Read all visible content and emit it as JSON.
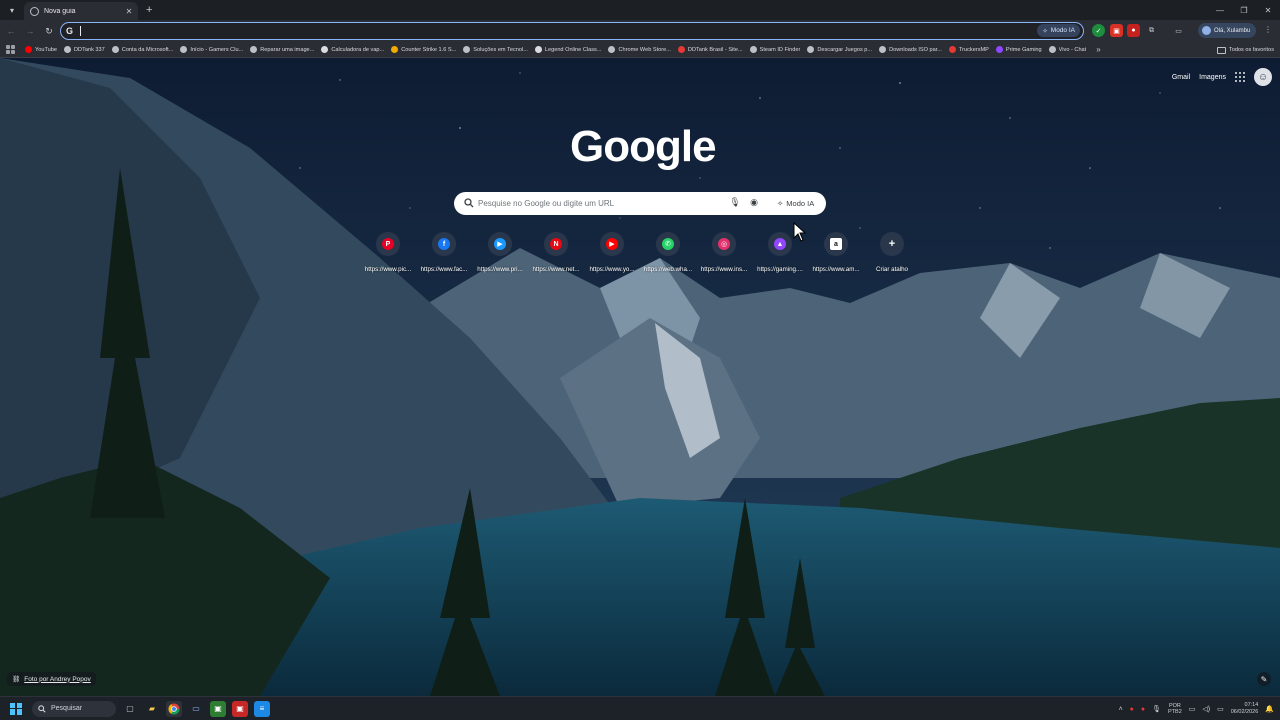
{
  "colors": {
    "accent": "#8ab4f8",
    "tab_bg": "#2a2d33",
    "frame_bg": "#1c1f24",
    "search_bg": "#ffffff"
  },
  "tabstrip": {
    "tab_title": "Nova guia",
    "close_icon": "close-icon",
    "new_tab_icon": "plus-icon"
  },
  "toolbar": {
    "omnibox_value": "",
    "omnibox_modo_ia": "Modo IA",
    "profile_label": "Olá, Xulambu"
  },
  "bookmarks": {
    "items": [
      {
        "label": "YouTube",
        "color": "#ff0000"
      },
      {
        "label": "DDTank 337",
        "color": "#bdc1c6"
      },
      {
        "label": "Conta da Microsoft...",
        "color": "#bdc1c6"
      },
      {
        "label": "Início - Gamers Clu...",
        "color": "#bdc1c6"
      },
      {
        "label": "Reparar uma image...",
        "color": "#bdc1c6"
      },
      {
        "label": "Calculadora de vap...",
        "color": "#dadce0"
      },
      {
        "label": "Counter Strike 1.6 S...",
        "color": "#f2a900"
      },
      {
        "label": "Soluções em Tecnol...",
        "color": "#bdc1c6"
      },
      {
        "label": "Legend Online Class...",
        "color": "#dadce0"
      },
      {
        "label": "Chrome Web Store...",
        "color": "#bdc1c6"
      },
      {
        "label": "DDTank Brasil - Site...",
        "color": "#e53935"
      },
      {
        "label": "Steam ID Finder",
        "color": "#bdc1c6"
      },
      {
        "label": "Descargar Juegos p...",
        "color": "#bdc1c6"
      },
      {
        "label": "Downloads ISO par...",
        "color": "#bdc1c6"
      },
      {
        "label": "TruckersMP",
        "color": "#e53935"
      },
      {
        "label": "Prime Gaming",
        "color": "#9146ff"
      },
      {
        "label": "Vivo - Chat",
        "color": "#bdc1c6"
      }
    ],
    "all_label": "Todos os favoritos"
  },
  "page": {
    "top_links": {
      "gmail": "Gmail",
      "images": "Imagens"
    },
    "logo": "Google",
    "search": {
      "placeholder": "Pesquise no Google ou digite um URL",
      "modo_ia": "Modo IA"
    },
    "shortcuts": [
      {
        "label": "https://www.pic...",
        "icon": "pinterest-icon",
        "color": "#e60023",
        "glyph": "P"
      },
      {
        "label": "https://www.fac...",
        "icon": "facebook-icon",
        "color": "#1877f2",
        "glyph": "f"
      },
      {
        "label": "https://www.pri...",
        "icon": "prime-video-icon",
        "color": "#1a98ff",
        "glyph": "▶"
      },
      {
        "label": "https://www.net...",
        "icon": "netflix-icon",
        "color": "#e50914",
        "glyph": "N"
      },
      {
        "label": "https://www.yo...",
        "icon": "youtube-icon",
        "color": "#ff0000",
        "glyph": "▶"
      },
      {
        "label": "https://web.wha...",
        "icon": "whatsapp-icon",
        "color": "#25d366",
        "glyph": "✆"
      },
      {
        "label": "https://www.ins...",
        "icon": "instagram-icon",
        "color": "#e1306c",
        "glyph": "◎"
      },
      {
        "label": "https://gaming....",
        "icon": "prime-gaming-icon",
        "color": "#9146ff",
        "glyph": "▲"
      },
      {
        "label": "https://www.am...",
        "icon": "amazon-icon",
        "color": "#ffffff",
        "glyph": "a"
      },
      {
        "label": "Criar atalho",
        "icon": "plus-icon",
        "color": "transparent",
        "glyph": "+"
      }
    ],
    "photo_credit": "Foto por Andrey Popov"
  },
  "taskbar": {
    "search_label": "Pesquisar",
    "lang_line1": "POR",
    "lang_line2": "PTB2",
    "time": "07:14",
    "date": "06/02/2026"
  }
}
